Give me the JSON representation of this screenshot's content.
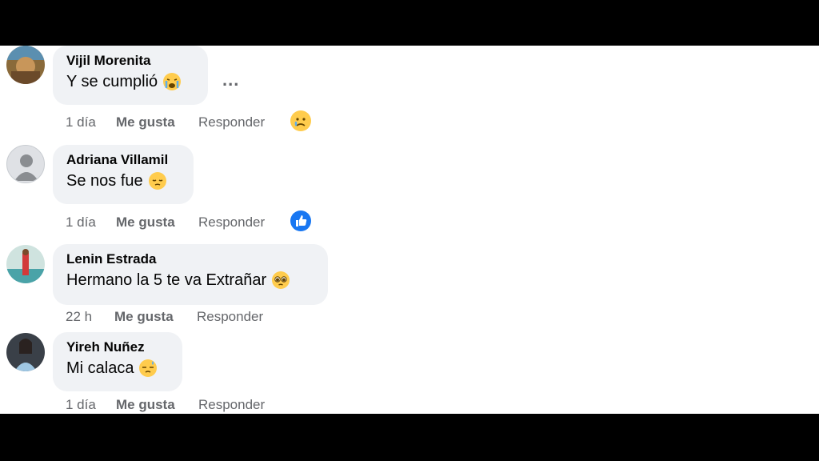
{
  "comments": [
    {
      "author": "Vijil Morenita",
      "text": "Y se cumplió",
      "emoji": "crying-face-icon",
      "time": "1 día",
      "like": "Me gusta",
      "reply": "Responder",
      "reaction": "sad-reaction-icon",
      "more": "..."
    },
    {
      "author": "Adriana Villamil",
      "text": "Se nos fue",
      "emoji": "pensive-face-icon",
      "time": "1 día",
      "like": "Me gusta",
      "reply": "Responder",
      "reaction": "like-reaction-icon"
    },
    {
      "author": "Lenin Estrada",
      "text": "Hermano la 5 te va Extrañar",
      "emoji": "pleading-face-icon",
      "time": "22 h",
      "like": "Me gusta",
      "reply": "Responder"
    },
    {
      "author": "Yireh Nuñez",
      "text": "Mi calaca",
      "emoji": "disappointed-relieved-face-icon",
      "time": "1 día",
      "like": "Me gusta",
      "reply": "Responder"
    }
  ],
  "colors": {
    "bubble": "#f0f2f5",
    "meta": "#65676b",
    "like_blue": "#1877f2",
    "emoji_yellow": "#ffcc4d"
  }
}
